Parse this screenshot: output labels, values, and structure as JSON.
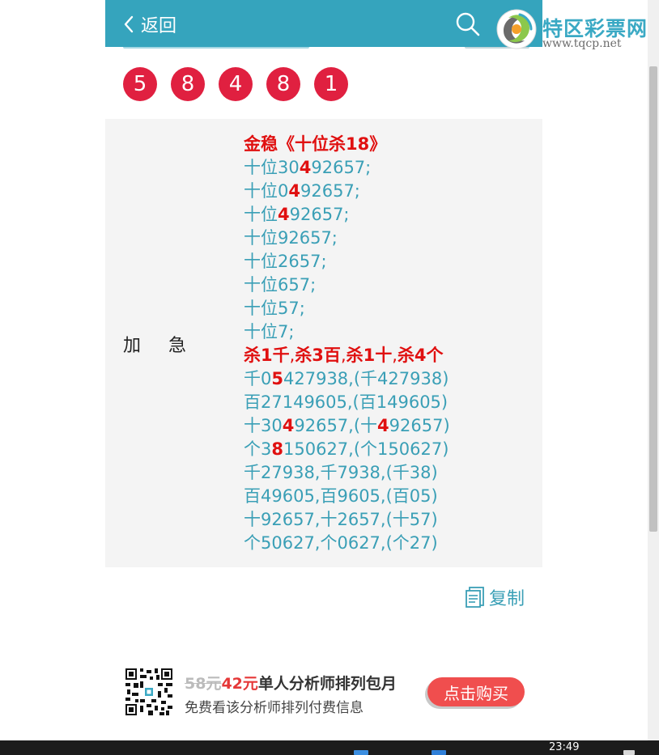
{
  "header": {
    "back_label": "返回",
    "back_icon": "chevron-left-icon",
    "search_icon": "search-icon"
  },
  "logo": {
    "name": "特区彩票网",
    "url": "www.tqcp.net"
  },
  "draw": {
    "numbers": [
      "5",
      "8",
      "4",
      "8",
      "1"
    ]
  },
  "content": {
    "row_label": "加急",
    "lines": [
      [
        {
          "t": "金稳《十位杀18》",
          "s": "head"
        }
      ],
      [
        {
          "t": "十位30"
        },
        {
          "t": "4",
          "s": "hl"
        },
        {
          "t": "92657;"
        }
      ],
      [
        {
          "t": "十位0"
        },
        {
          "t": "4",
          "s": "hl"
        },
        {
          "t": "92657;"
        }
      ],
      [
        {
          "t": "十位"
        },
        {
          "t": "4",
          "s": "hl"
        },
        {
          "t": "92657;"
        }
      ],
      [
        {
          "t": "十位92657;"
        }
      ],
      [
        {
          "t": "十位2657;"
        }
      ],
      [
        {
          "t": "十位657;"
        }
      ],
      [
        {
          "t": "十位57;"
        }
      ],
      [
        {
          "t": "十位7;"
        }
      ],
      [
        {
          "t": "杀1千",
          "s": "hl"
        },
        {
          "t": ",",
          "s": "sep"
        },
        {
          "t": "杀3百",
          "s": "hl"
        },
        {
          "t": ",",
          "s": "sep"
        },
        {
          "t": "杀1十",
          "s": "hl"
        },
        {
          "t": ",",
          "s": "sep"
        },
        {
          "t": "杀4个",
          "s": "hl"
        }
      ],
      [
        {
          "t": "千0"
        },
        {
          "t": "5",
          "s": "hl"
        },
        {
          "t": "427938,(千427938)"
        }
      ],
      [
        {
          "t": "百27149605,(百149605)"
        }
      ],
      [
        {
          "t": "十30"
        },
        {
          "t": "4",
          "s": "hl"
        },
        {
          "t": "92657,(十"
        },
        {
          "t": "4",
          "s": "hl"
        },
        {
          "t": "92657)"
        }
      ],
      [
        {
          "t": "个3"
        },
        {
          "t": "8",
          "s": "hl"
        },
        {
          "t": "150627,(个150627)"
        }
      ],
      [
        {
          "t": "千27938,千7938,(千38)"
        }
      ],
      [
        {
          "t": "百49605,百9605,(百05)"
        }
      ],
      [
        {
          "t": "十92657,十2657,(十57)"
        }
      ],
      [
        {
          "t": "个50627,个0627,(个27)"
        }
      ]
    ]
  },
  "copy": {
    "label": "复制",
    "icon": "document-copy-icon"
  },
  "promo": {
    "old_price": "58元",
    "new_price": "42元",
    "package": "单人分析师排列包月",
    "subtitle": "免费看该分析师排列付费信息",
    "buy_label": "点击购买",
    "qr_icon": "qr-code-icon"
  },
  "taskbar": {
    "time": "23:49"
  },
  "colors": {
    "header_bg": "#35a4bd",
    "ball_red": "#e02040",
    "text_teal": "#3a9fb6",
    "highlight_red": "#e01010",
    "buy_button": "#f04e4e"
  }
}
